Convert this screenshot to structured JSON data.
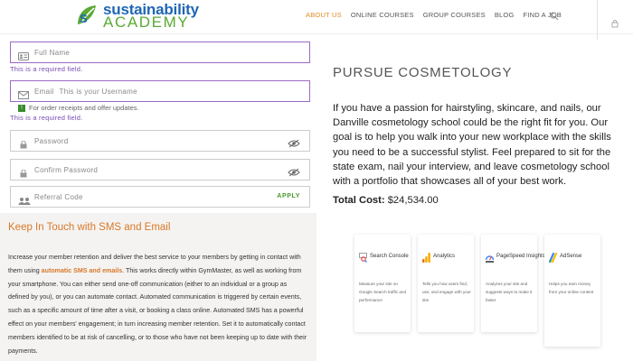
{
  "header": {
    "logo_line1": "sustainability",
    "logo_line2": "ACADEMY",
    "nav": [
      "ABOUT US",
      "ONLINE COURSES",
      "GROUP COURSES",
      "BLOG",
      "FIND A JOB"
    ],
    "active_nav": "ABOUT US",
    "accent_color": "#e08a1e"
  },
  "form": {
    "full_name_placeholder": "Full Name",
    "email_placeholder": "Email",
    "email_hint": "This is your Username",
    "required_error": "This is a required field.",
    "receipts_note": "For order receipts and offer updates.",
    "password_placeholder": "Password",
    "confirm_password_placeholder": "Confirm Password",
    "referral_placeholder": "Referral Code",
    "apply_label": "APPLY"
  },
  "sms": {
    "title": "Keep In Touch with SMS and Email",
    "p_before": "Increase your member retention and deliver the best service to your members by getting in contact with them using ",
    "p_bold": "automatic SMS and emails",
    "p_after": ". This works directly within GymMaster, as well as working from your smartphone. You can either send one-off communication (either to an individual or a group as defined by you), or you can automate contact. Automated communication is triggered by certain events, such as a specific amount of time after a visit, or booking a class online. Automated SMS has a powerful effect on your members' engagement; in turn increasing member retention. Set it to automatically contact members identified to be at risk of cancelling, or to those who have not been keeping up to date with their payments."
  },
  "main": {
    "title": "PURSUE COSMETOLOGY",
    "body": "If you have a passion for hairstyling, skincare, and nails, our Danville cosmetology school could be the right fit for you. Our goal is to help you walk into your new workplace with the skills you need to be a successful stylist. Feel prepared to sit for the state exam, nail your interview, and leave cosmetology school with a portfolio that showcases all of your best work.",
    "cost_label": "Total Cost:",
    "cost_value": "$24,534.00"
  },
  "cards": [
    {
      "title": "Search Console",
      "desc": "Measure your site on Google Search traffic and performance",
      "icon": "search-console-icon"
    },
    {
      "title": "Analytics",
      "desc": "Tells you how users find, use, and engage with your site",
      "icon": "analytics-icon"
    },
    {
      "title": "PageSpeed Insights",
      "desc": "Analyzes your site and suggests ways to make it faster",
      "icon": "pagespeed-icon"
    },
    {
      "title": "AdSense",
      "desc": "Helps you earn money from your online content",
      "icon": "adsense-icon"
    }
  ]
}
